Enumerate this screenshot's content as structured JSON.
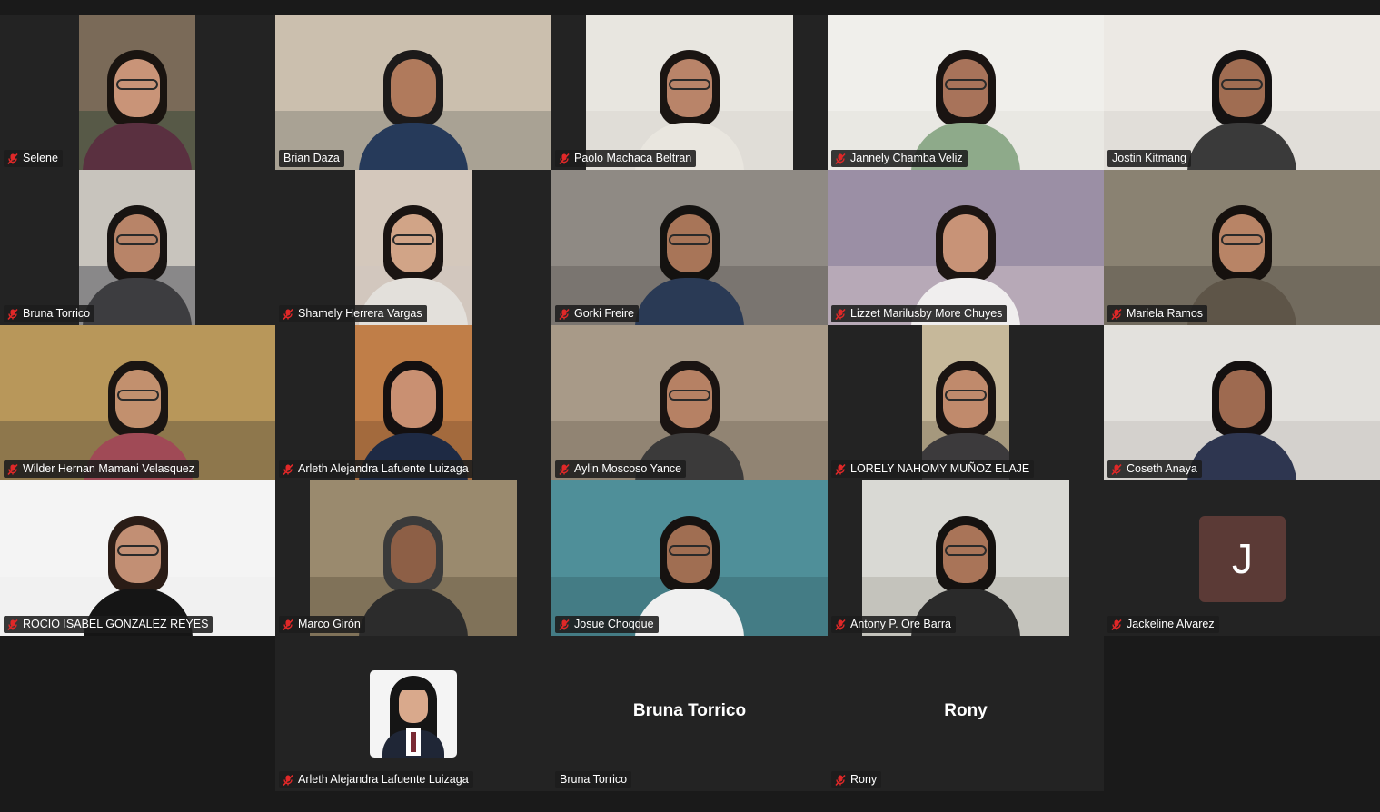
{
  "meeting": {
    "participants": [
      {
        "name": "Selene",
        "muted": true,
        "bg": "#7a6a58",
        "floor": "#3b4a3a",
        "hair": "#1a1410",
        "skin": "#c99478",
        "shirt": "#5a3040",
        "glasses": true
      },
      {
        "name": "Brian Daza",
        "muted": false,
        "bg": "#cbbfae",
        "floor": "#8e8a80",
        "hair": "#1c1a1a",
        "skin": "#b07a5c",
        "shirt": "#263a5a",
        "glasses": false,
        "speaking": true
      },
      {
        "name": "Paolo Machaca Beltran",
        "muted": true,
        "bg": "#e8e6e0",
        "floor": "#d8d6d0",
        "hair": "#1a1512",
        "skin": "#b98469",
        "shirt": "#e9e6df",
        "glasses": true
      },
      {
        "name": "Jannely Chamba Veliz",
        "muted": true,
        "bg": "#f0efeb",
        "floor": "#e3e1dc",
        "hair": "#1a1412",
        "skin": "#a8735a",
        "shirt": "#8eaa8a",
        "glasses": true
      },
      {
        "name": "Jostin Kitmang",
        "muted": false,
        "bg": "#ece9e4",
        "floor": "#d9d6d0",
        "hair": "#141212",
        "skin": "#a06d52",
        "shirt": "#3a3a3a",
        "glasses": true
      },
      {
        "name": "Bruna Torrico",
        "muted": true,
        "bg": "#c8c4bd",
        "floor": "#55585e",
        "hair": "#181412",
        "skin": "#b88468",
        "shirt": "#3d3d40",
        "glasses": true
      },
      {
        "name": "Shamely Herrera Vargas",
        "muted": true,
        "bg": "#d4c8bc",
        "floor": "#cfc7bf",
        "hair": "#1a1412",
        "skin": "#d1a487",
        "shirt": "#e3e0db",
        "glasses": true
      },
      {
        "name": "Gorki Freire",
        "muted": true,
        "bg": "#8f8a84",
        "floor": "#6a6560",
        "hair": "#141210",
        "skin": "#a87558",
        "shirt": "#2a3a55",
        "glasses": true
      },
      {
        "name": "Lizzet Marilusby More Chuyes",
        "muted": true,
        "bg": "#9b8fa5",
        "floor": "#cdbfc7",
        "hair": "#1c1512",
        "skin": "#c89377",
        "shirt": "#f0eeee",
        "glasses": false
      },
      {
        "name": "Mariela Ramos",
        "muted": true,
        "bg": "#8a8272",
        "floor": "#5f5a4e",
        "hair": "#16110e",
        "skin": "#b88466",
        "shirt": "#5e5548",
        "glasses": true
      },
      {
        "name": "Wilder Hernan Mamani Velasquez",
        "muted": true,
        "bg": "#b8975a",
        "floor": "#6c5d42",
        "hair": "#1a1512",
        "skin": "#c2906e",
        "shirt": "#a04a56",
        "glasses": true
      },
      {
        "name": "Arleth Alejandra Lafuente Luizaga",
        "muted": true,
        "bg": "#c07e48",
        "floor": "#8a5a34",
        "hair": "#141010",
        "skin": "#c99072",
        "shirt": "#1e2a44",
        "glasses": false
      },
      {
        "name": "Aylin Moscoso Yance",
        "muted": true,
        "bg": "#a89a88",
        "floor": "#7e7262",
        "hair": "#1a1412",
        "skin": "#b68164",
        "shirt": "#3b3a3a",
        "glasses": true
      },
      {
        "name": "LORELY NAHOMY MUÑOZ ELAJE",
        "muted": true,
        "bg": "#c6b89a",
        "floor": "#8a7e66",
        "hair": "#1a1412",
        "skin": "#c08a6c",
        "shirt": "#3c3a3c",
        "glasses": true
      },
      {
        "name": "Coseth Anaya",
        "muted": true,
        "bg": "#e3e1dd",
        "floor": "#c8c5c0",
        "hair": "#141010",
        "skin": "#9e6a50",
        "shirt": "#2e3650",
        "glasses": false
      },
      {
        "name": "ROCIO ISABEL GONZALEZ REYES",
        "muted": true,
        "bg": "#f4f4f4",
        "floor": "#eeeeee",
        "hair": "#2a1c16",
        "skin": "#c28f74",
        "shirt": "#151515",
        "glasses": true
      },
      {
        "name": "Marco Girón",
        "muted": true,
        "bg": "#9a8a6e",
        "floor": "#6b5e48",
        "hair": "#3a3a3a",
        "skin": "#8d5f46",
        "shirt": "#2c2c2c",
        "glasses": false
      },
      {
        "name": "Josue Choqque",
        "muted": true,
        "bg": "#4f8f99",
        "floor": "#3d6e74",
        "hair": "#161210",
        "skin": "#a06e52",
        "shirt": "#f0f0f0",
        "glasses": true
      },
      {
        "name": "Antony P. Ore Barra",
        "muted": true,
        "bg": "#d9d9d4",
        "floor": "#b3b0a8",
        "hair": "#151210",
        "skin": "#a97458",
        "shirt": "#2a2a2a",
        "glasses": true
      },
      {
        "name": "Jackeline Alvarez",
        "muted": true,
        "initial": "J"
      },
      {
        "name": "Arleth Alejandra Lafuente Luizaga",
        "muted": true,
        "photo": true
      },
      {
        "name": "Bruna Torrico",
        "muted": false,
        "center_name": "Bruna Torrico"
      },
      {
        "name": "Rony",
        "muted": true,
        "center_name": "Rony"
      }
    ]
  }
}
